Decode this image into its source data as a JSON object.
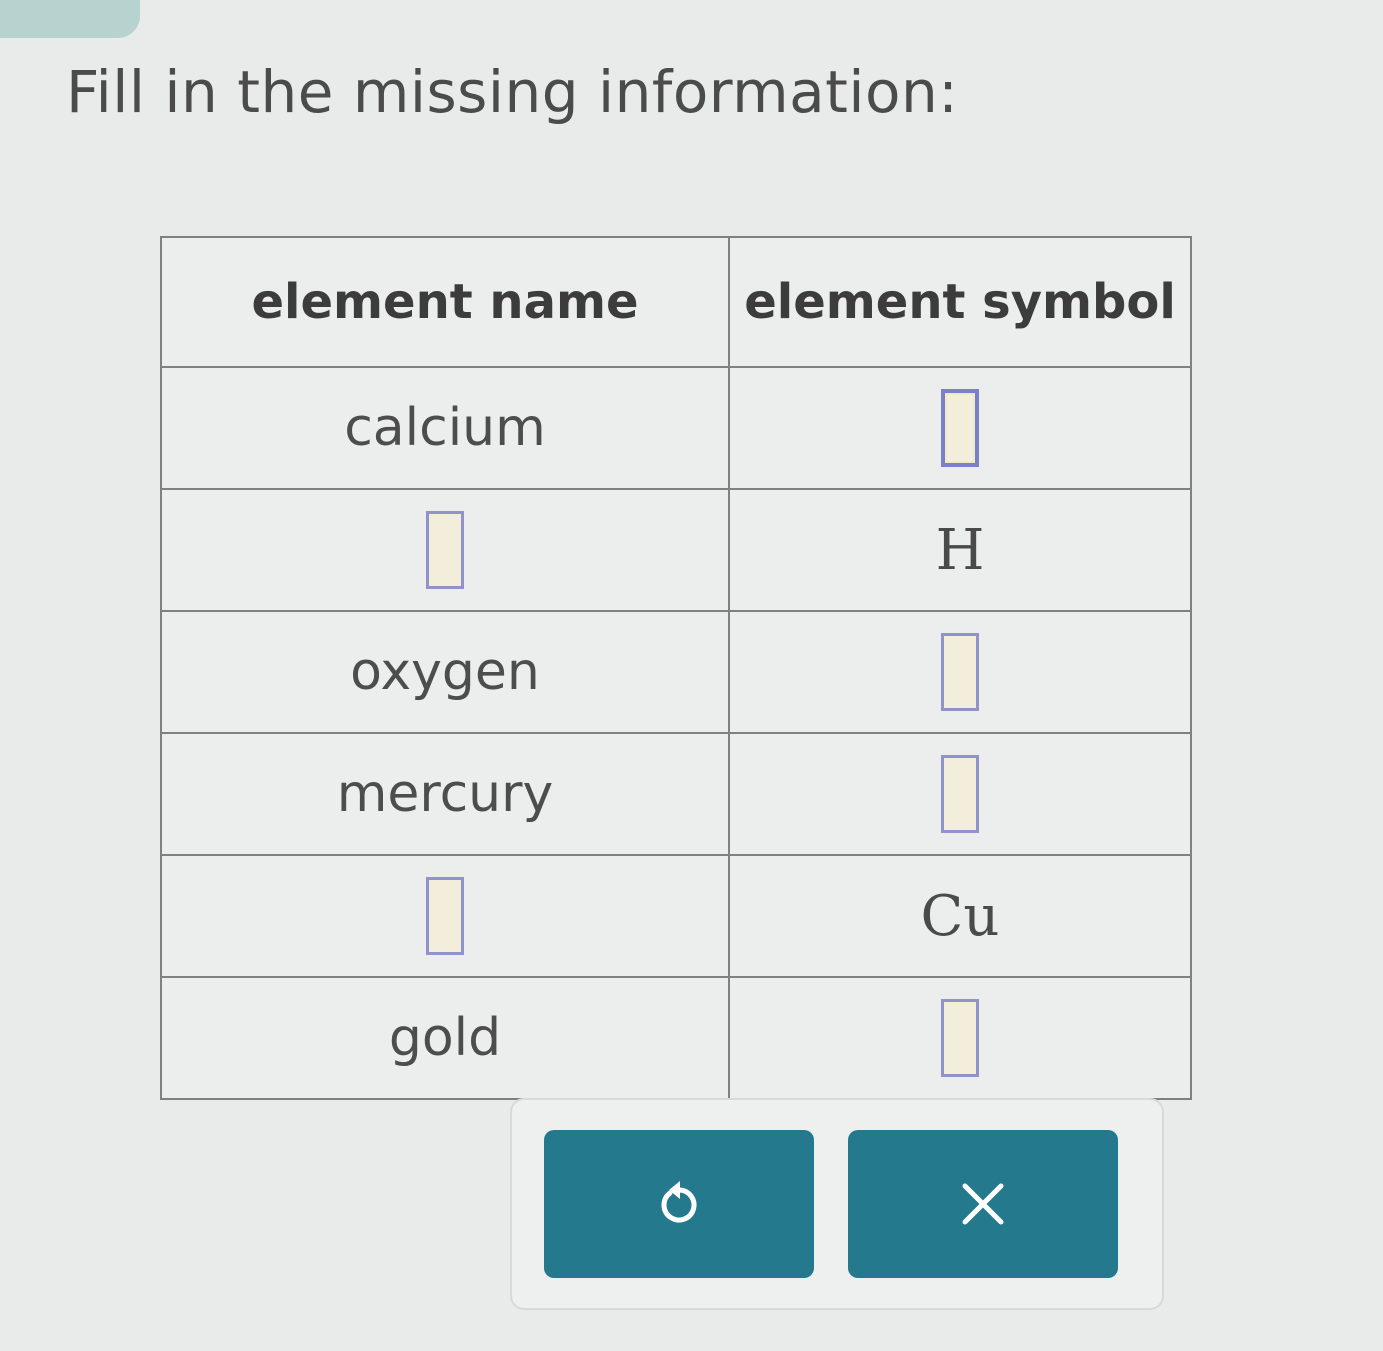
{
  "prompt": "Fill in the missing information:",
  "table": {
    "headers": {
      "name": "element name",
      "symbol": "element symbol"
    },
    "rows": [
      {
        "name": "calcium",
        "symbol": ""
      },
      {
        "name": "",
        "symbol": "H"
      },
      {
        "name": "oxygen",
        "symbol": ""
      },
      {
        "name": "mercury",
        "symbol": ""
      },
      {
        "name": "",
        "symbol": "Cu"
      },
      {
        "name": "gold",
        "symbol": ""
      }
    ]
  },
  "buttons": {
    "undo_icon": "undo-icon",
    "clear_icon": "close-icon"
  },
  "colors": {
    "button": "#24798d",
    "answer_box_border": "#8f93c9",
    "answer_box_fill": "#f2eedb",
    "accent_tab": "#b7d3cf"
  }
}
